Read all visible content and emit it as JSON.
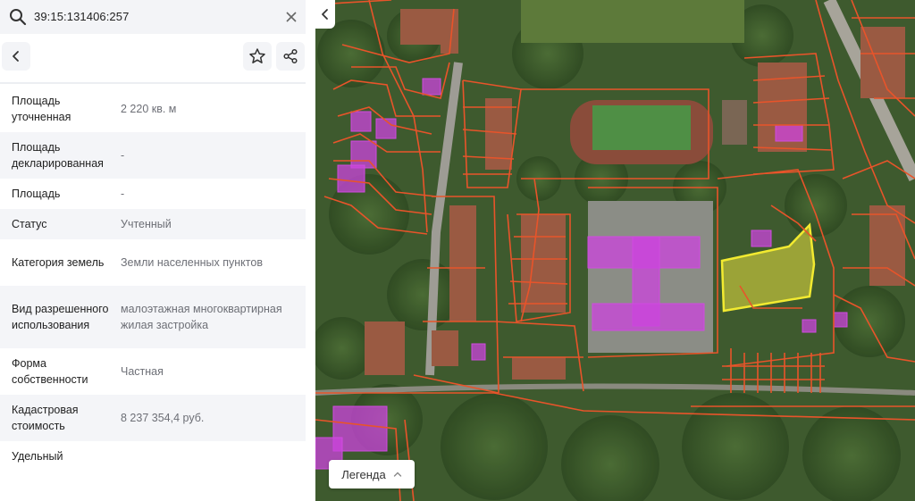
{
  "search": {
    "value": "39:15:131406:257"
  },
  "properties": [
    {
      "label": "Площадь уточненная",
      "value": "2 220 кв. м"
    },
    {
      "label": "Площадь декларированная",
      "value": "-"
    },
    {
      "label": "Площадь",
      "value": "-"
    },
    {
      "label": "Статус",
      "value": "Учтенный"
    },
    {
      "label": "Категория земель",
      "value": "Земли населенных пунктов"
    },
    {
      "label": "Вид разрешенного использования",
      "value": "малоэтажная многоквартирная жилая застройка"
    },
    {
      "label": "Форма собственности",
      "value": "Частная"
    },
    {
      "label": "Кадастровая стоимость",
      "value": "8 237 354,4 руб."
    },
    {
      "label": "Удельный",
      "value": ""
    }
  ],
  "map": {
    "legend_label": "Легенда"
  },
  "colors": {
    "parcel_border": "#e8542a",
    "building": "#cc44dd",
    "selected_parcel": "#e8e040",
    "panel_alt_row": "#f4f5f8"
  },
  "icons": [
    "search-icon",
    "close-icon",
    "back-icon",
    "star-icon",
    "share-icon",
    "collapse-panel-icon",
    "chevron-up-icon"
  ]
}
